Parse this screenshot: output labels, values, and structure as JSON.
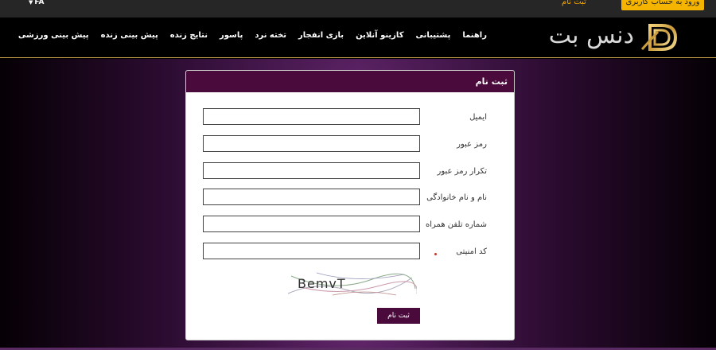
{
  "topbar": {
    "language": "FA",
    "register_link": "ثبت نام",
    "login_button": "ورود به حساب کاربری"
  },
  "header": {
    "logo_text": "دنس بت",
    "nav": [
      "پیش بینی ورزشی",
      "پیش بینی زنده",
      "نتایج زنده",
      "پاسور",
      "تخته نرد",
      "بازی انفجار",
      "کازینو آنلاین",
      "پشتیبانی",
      "راهنما"
    ]
  },
  "form": {
    "title": "ثبت نام",
    "fields": [
      {
        "label": "ایمیل",
        "value": ""
      },
      {
        "label": "رمز عبور",
        "value": ""
      },
      {
        "label": "تکرار رمز عبور",
        "value": ""
      },
      {
        "label": "نام و نام خانوادگی",
        "value": ""
      },
      {
        "label": "شماره تلفن همراه",
        "value": ""
      },
      {
        "label": "کد امنیتی",
        "value": ""
      }
    ],
    "captcha_text": "BemvT",
    "submit_label": "ثبت نام"
  },
  "colors": {
    "accent": "#f5b400",
    "panel_header": "#4a0a3c",
    "background_purple": "#55205e"
  }
}
